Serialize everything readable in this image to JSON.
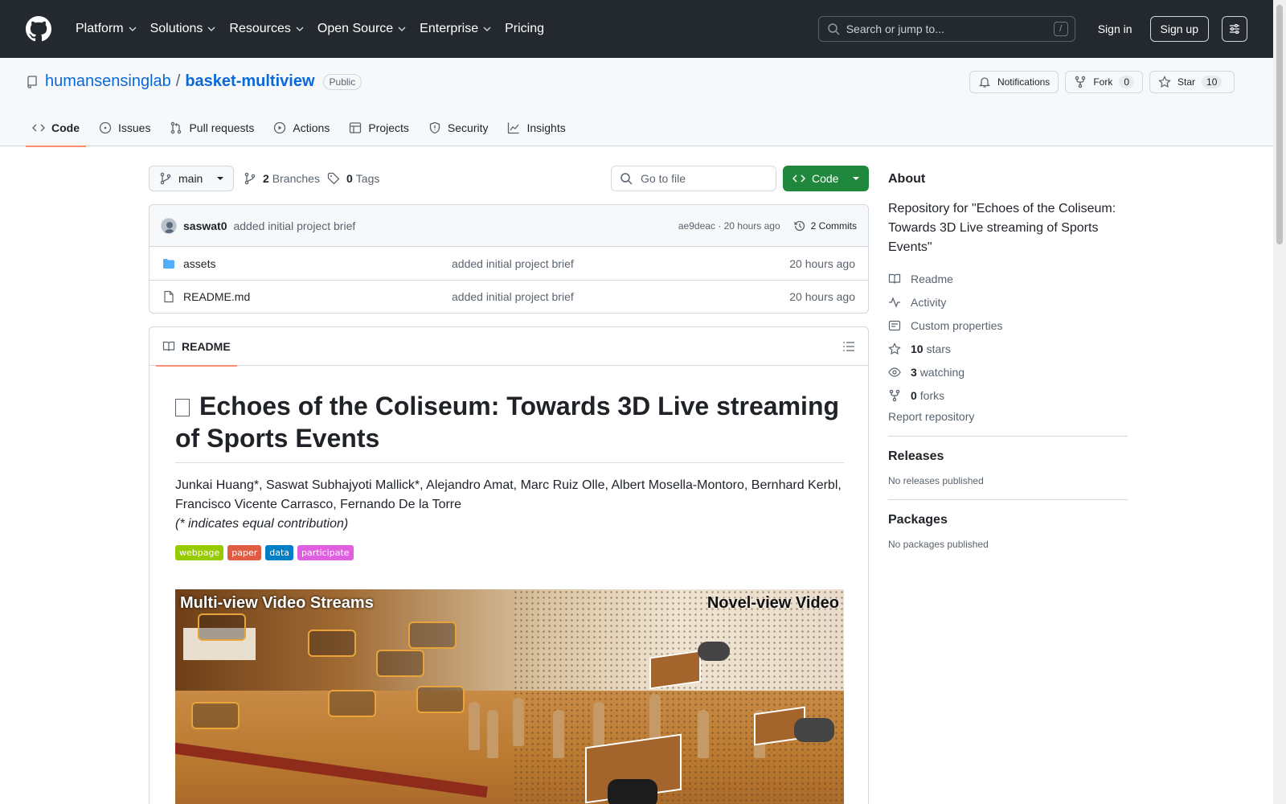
{
  "header": {
    "nav": [
      {
        "label": "Platform",
        "has_menu": true
      },
      {
        "label": "Solutions",
        "has_menu": true
      },
      {
        "label": "Resources",
        "has_menu": true
      },
      {
        "label": "Open Source",
        "has_menu": true
      },
      {
        "label": "Enterprise",
        "has_menu": true
      },
      {
        "label": "Pricing",
        "has_menu": false
      }
    ],
    "search_placeholder": "Search or jump to...",
    "search_shortcut": "/",
    "sign_in": "Sign in",
    "sign_up": "Sign up"
  },
  "repo": {
    "owner": "humansensinglab",
    "separator": "/",
    "name": "basket-multiview",
    "visibility": "Public",
    "notifications_label": "Notifications",
    "fork_label": "Fork",
    "fork_count": "0",
    "star_label": "Star",
    "star_count": "10",
    "tabs": [
      {
        "label": "Code",
        "icon": "code-icon",
        "active": true
      },
      {
        "label": "Issues",
        "icon": "issue-icon",
        "active": false
      },
      {
        "label": "Pull requests",
        "icon": "pull-request-icon",
        "active": false
      },
      {
        "label": "Actions",
        "icon": "play-icon",
        "active": false
      },
      {
        "label": "Projects",
        "icon": "table-icon",
        "active": false
      },
      {
        "label": "Security",
        "icon": "shield-icon",
        "active": false
      },
      {
        "label": "Insights",
        "icon": "graph-icon",
        "active": false
      }
    ]
  },
  "filenav": {
    "branch": "main",
    "branches_count": "2",
    "branches_label": "Branches",
    "tags_count": "0",
    "tags_label": "Tags",
    "goto_placeholder": "Go to file",
    "code_button": "Code"
  },
  "commit": {
    "author": "saswat0",
    "message": "added initial project brief",
    "hash": "ae9deac",
    "separator": " · ",
    "time": "20 hours ago",
    "commits_label": "2 Commits"
  },
  "files": [
    {
      "name": "assets",
      "type": "folder",
      "message": "added initial project brief",
      "date": "20 hours ago"
    },
    {
      "name": "README.md",
      "type": "file",
      "message": "added initial project brief",
      "date": "20 hours ago"
    }
  ],
  "readme": {
    "tab_label": "README",
    "title": "Echoes of the Coliseum: Towards 3D Live streaming of Sports Events",
    "authors": "Junkai Huang*, Saswat Subhajyoti Mallick*, Alejandro Amat, Marc Ruiz Olle, Albert Mosella-Montoro, Bernhard Kerbl, Francisco Vicente Carrasco, Fernando De la Torre",
    "contribution_note": "(* indicates equal contribution)",
    "badges": [
      {
        "label": "webpage",
        "color": "#97ca00"
      },
      {
        "label": "paper",
        "color": "#e05d44"
      },
      {
        "label": "data",
        "color": "#007ec6"
      },
      {
        "label": "participate",
        "color": "#e05ee0"
      }
    ],
    "hero_left_label": "Multi-view Video Streams",
    "hero_right_label": "Novel-view Video"
  },
  "about": {
    "heading": "About",
    "description": "Repository for \"Echoes of the Coliseum: Towards 3D Live streaming of Sports Events\"",
    "readme": "Readme",
    "activity": "Activity",
    "custom_properties": "Custom properties",
    "stars_count": "10",
    "stars_label": "stars",
    "watching_count": "3",
    "watching_label": "watching",
    "forks_count": "0",
    "forks_label": "forks",
    "report": "Report repository"
  },
  "releases": {
    "heading": "Releases",
    "note": "No releases published"
  },
  "packages": {
    "heading": "Packages",
    "note": "No packages published"
  },
  "colors": {
    "accent": "#0969da",
    "green": "#1f883d",
    "tab_underline": "#fd8c73",
    "header_bg": "#24292f"
  }
}
